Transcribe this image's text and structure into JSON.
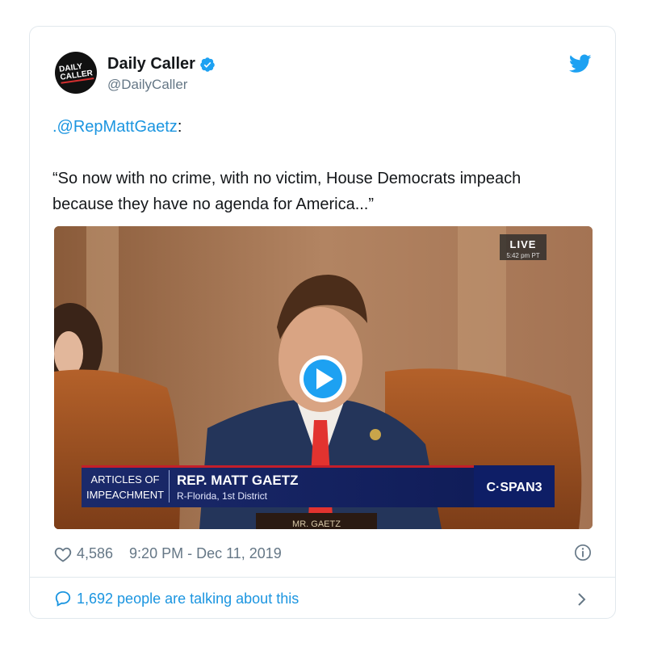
{
  "tweet": {
    "author": {
      "display_name": "Daily Caller",
      "handle": "@DailyCaller",
      "avatar_logo_line1": "DAILY",
      "avatar_logo_line2": "CALLER",
      "verified": true
    },
    "mention": ".@RepMattGaetz",
    "mention_suffix": ":",
    "quote": "“So now with no crime, with no victim, House Democrats impeach because they have no agenda for America...”",
    "likes": "4,586",
    "time": "9:20 PM - Dec 11, 2019",
    "talking": "1,692 people are talking about this"
  },
  "video": {
    "live_label": "LIVE",
    "live_time": "5:42 pm PT",
    "lower_third_left_1": "ARTICLES OF",
    "lower_third_left_2": "IMPEACHMENT",
    "lower_third_name": "REP. MATT GAETZ",
    "lower_third_sub": "R-Florida, 1st District",
    "network": "C·SPAN3",
    "nameplate": "MR. GAETZ"
  },
  "colors": {
    "link": "#1b95e0",
    "muted": "#657786",
    "border": "#e1e8ed",
    "text": "#14171a"
  },
  "icons": [
    "verified-badge-icon",
    "twitter-bird-icon",
    "play-icon",
    "heart-icon",
    "info-icon",
    "reply-bubble-icon",
    "chevron-right-icon"
  ]
}
